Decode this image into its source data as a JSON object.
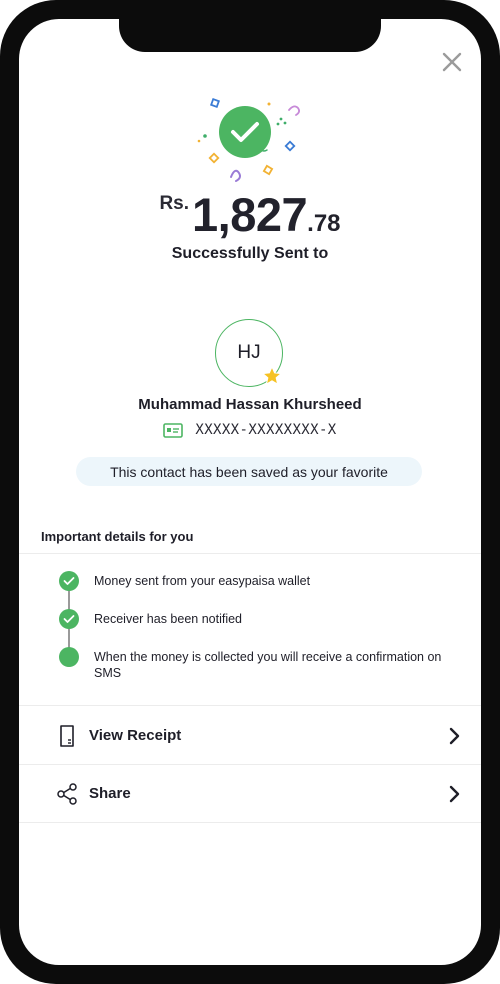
{
  "payment": {
    "currency": "Rs.",
    "amount_whole": "1,827",
    "amount_decimal": ".78",
    "status": "Successfully Sent to"
  },
  "recipient": {
    "initials": "HJ",
    "name": "Muhammad Hassan Khursheed",
    "id_number": "XXXXX-XXXXXXXX-X",
    "favorite_message": "This contact has been saved as your favorite"
  },
  "details": {
    "heading": "Important details for you",
    "steps": [
      {
        "text": "Money sent from your easypaisa wallet",
        "done": true
      },
      {
        "text": "Receiver has been notified",
        "done": true
      },
      {
        "text": "When the money is collected you will receive a confirmation on SMS",
        "done": false
      }
    ]
  },
  "actions": {
    "view_receipt": "View Receipt",
    "share": "Share"
  },
  "colors": {
    "success_green": "#4cb562",
    "favorite_banner_bg": "#edf6fb",
    "star_yellow": "#f6c224"
  },
  "icons": {
    "close": "close-icon",
    "success": "checkmark-circle-icon",
    "favorite": "star-icon",
    "id_card": "id-card-icon",
    "step_done": "check-icon",
    "receipt": "receipt-icon",
    "share": "share-icon",
    "chevron": "chevron-right-icon"
  }
}
